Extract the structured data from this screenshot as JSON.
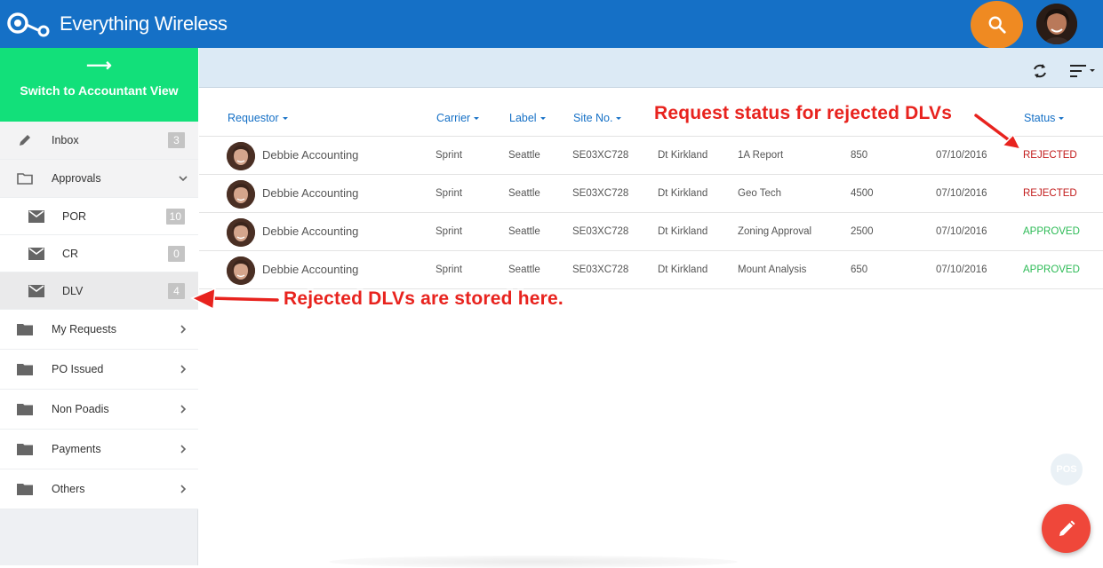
{
  "app": {
    "title": "Everything Wireless"
  },
  "header": {
    "search_icon": "search-icon",
    "accent": "#1570c6",
    "search_color": "#ef8a22"
  },
  "sidebar": {
    "switch_label": "Switch to Accountant View",
    "switch_arrow": "⟶",
    "items": [
      {
        "label": "Inbox",
        "badge": "3"
      },
      {
        "label": "Approvals"
      },
      {
        "label": "POR",
        "badge": "10"
      },
      {
        "label": "CR",
        "badge": "0"
      },
      {
        "label": "DLV",
        "badge": "4"
      },
      {
        "label": "My Requests"
      },
      {
        "label": "PO Issued"
      },
      {
        "label": "Non Poadis"
      },
      {
        "label": "Payments"
      },
      {
        "label": "Others"
      }
    ]
  },
  "table": {
    "headers": {
      "requestor": "Requestor",
      "carrier": "Carrier",
      "label": "Label",
      "site": "Site No.",
      "status": "Status"
    },
    "rows": [
      {
        "requestor": "Debbie Accounting",
        "carrier": "Sprint",
        "label": "Seattle",
        "site": "SE03XC728",
        "location": "Dt Kirkland",
        "service": "1A Report",
        "amount": "850",
        "date": "07/10/2016",
        "status": "REJECTED"
      },
      {
        "requestor": "Debbie Accounting",
        "carrier": "Sprint",
        "label": "Seattle",
        "site": "SE03XC728",
        "location": "Dt Kirkland",
        "service": "Geo Tech",
        "amount": "4500",
        "date": "07/10/2016",
        "status": "REJECTED"
      },
      {
        "requestor": "Debbie Accounting",
        "carrier": "Sprint",
        "label": "Seattle",
        "site": "SE03XC728",
        "location": "Dt Kirkland",
        "service": "Zoning Approval",
        "amount": "2500",
        "date": "07/10/2016",
        "status": "APPROVED"
      },
      {
        "requestor": "Debbie Accounting",
        "carrier": "Sprint",
        "label": "Seattle",
        "site": "SE03XC728",
        "location": "Dt Kirkland",
        "service": "Mount Analysis",
        "amount": "650",
        "date": "07/10/2016",
        "status": "APPROVED"
      }
    ]
  },
  "annotations": {
    "status_note": "Request status for rejected DLVs",
    "dlv_note": "Rejected DLVs are stored here."
  },
  "floating": {
    "pos_label": "POS"
  },
  "colors": {
    "rejected": "#c21c1c",
    "approved": "#2dbb56",
    "switch": "#12e07a",
    "fab": "#ef473a"
  }
}
